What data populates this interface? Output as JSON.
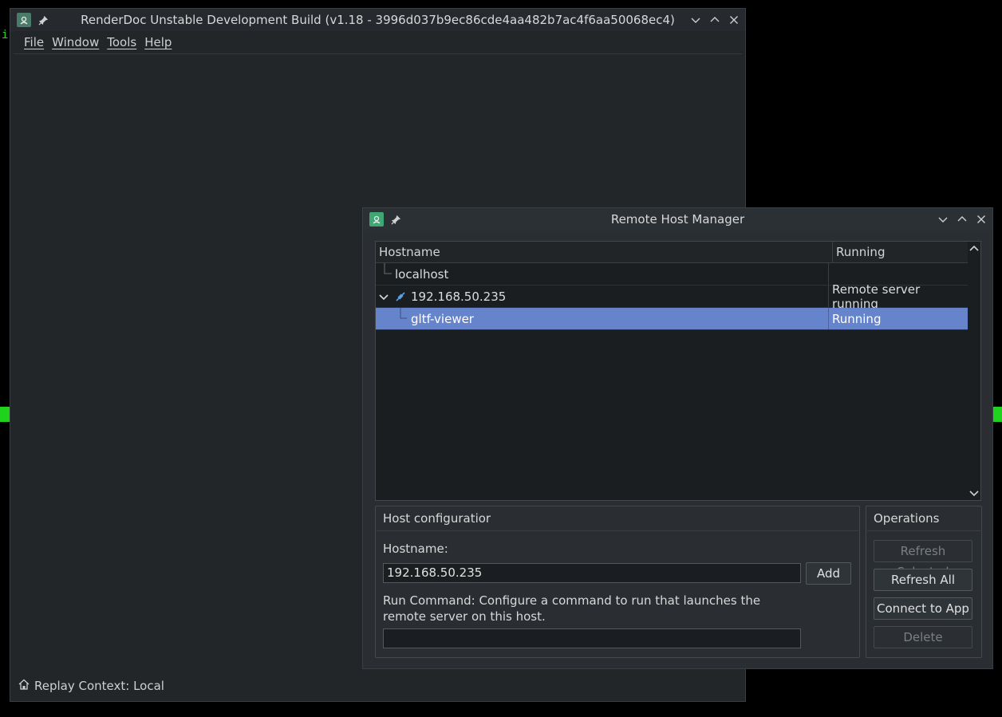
{
  "terminal": {
    "char": "i"
  },
  "main_window": {
    "title": "RenderDoc Unstable Development Build (v1.18 - 3996d037b9ec86cde4aa482b7ac4f6aa50068ec4)",
    "menu": [
      "File",
      "Window",
      "Tools",
      "Help"
    ],
    "status": "Replay Context: Local"
  },
  "dialog": {
    "title": "Remote Host Manager",
    "table": {
      "columns": [
        "Hostname",
        "Running"
      ],
      "rows": [
        {
          "hostname": "localhost",
          "running": ""
        },
        {
          "hostname": "192.168.50.235",
          "running": "Remote server running"
        },
        {
          "hostname": "gltf-viewer",
          "running": "Running"
        }
      ]
    },
    "host_config": {
      "title": "Host configuratior",
      "hostname_label": "Hostname:",
      "hostname_value": "192.168.50.235",
      "add_label": "Add",
      "run_command_label": "Run Command: Configure a command to run that launches the remote server on this host.",
      "run_command_value": ""
    },
    "operations": {
      "title": "Operations",
      "refresh_selected": "Refresh Selected",
      "refresh_all": "Refresh All",
      "connect": "Connect to App",
      "delete": "Delete"
    }
  },
  "colors": {
    "selection": "#6684cc",
    "accent_icon": "#3fa674",
    "terminal_green": "#1ed21e"
  }
}
